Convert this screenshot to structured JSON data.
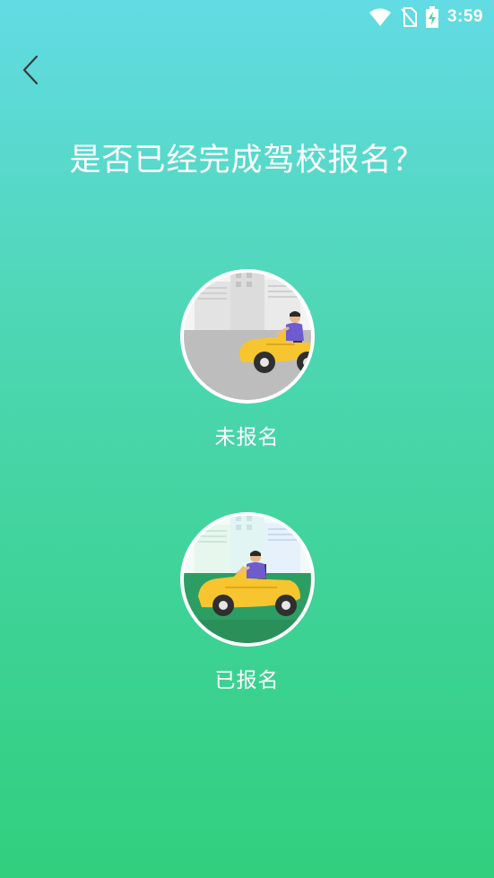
{
  "status_bar": {
    "time": "3:59",
    "icons": [
      "wifi-icon",
      "no-sim-icon",
      "battery-charging-icon"
    ]
  },
  "nav": {
    "back_icon": "chevron-left-icon"
  },
  "page": {
    "title": "是否已经完成驾校报名？"
  },
  "options": [
    {
      "label": "未报名",
      "illustration": "car-gray-road-illustration",
      "road_color": "#bdbdbd"
    },
    {
      "label": "已报名",
      "illustration": "car-green-road-illustration",
      "road_color": "#2d9e63"
    }
  ],
  "colors": {
    "gradient_top": "#62dbe4",
    "gradient_bottom": "#31cf7e",
    "car_yellow": "#f7c52f",
    "driver_shirt": "#6e5bd0"
  }
}
